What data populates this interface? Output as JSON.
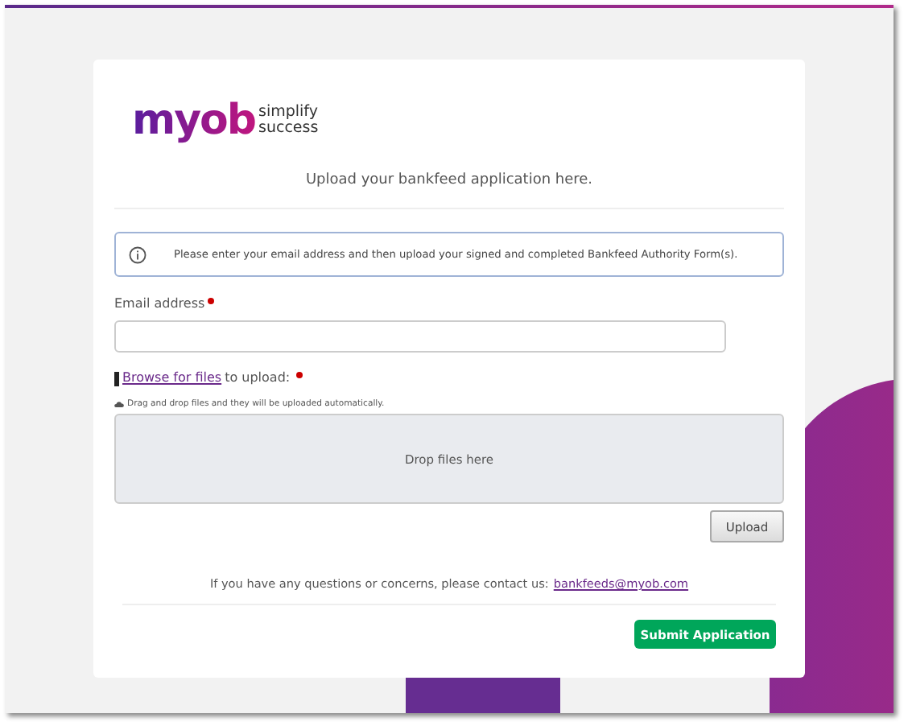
{
  "logo": {
    "wordmark": "myob",
    "tagline": [
      "simplify",
      "success"
    ]
  },
  "heading": "Upload your bankfeed application here.",
  "info": "Please enter your email address and then upload your signed and completed Bankfeed Authority Form(s).",
  "email": {
    "label": "Email address",
    "required": true
  },
  "files": {
    "link": "Browse for files",
    "label": "to upload:",
    "required": true,
    "hint": "Drag and drop files and they will be uploaded automatically.",
    "dropzone": "Drop files here",
    "upload_button": "Upload"
  },
  "contact": {
    "text": "If you have any questions or concerns, please contact us:",
    "email": "bankfeeds@myob.com"
  },
  "submit_button": "Submit Application"
}
